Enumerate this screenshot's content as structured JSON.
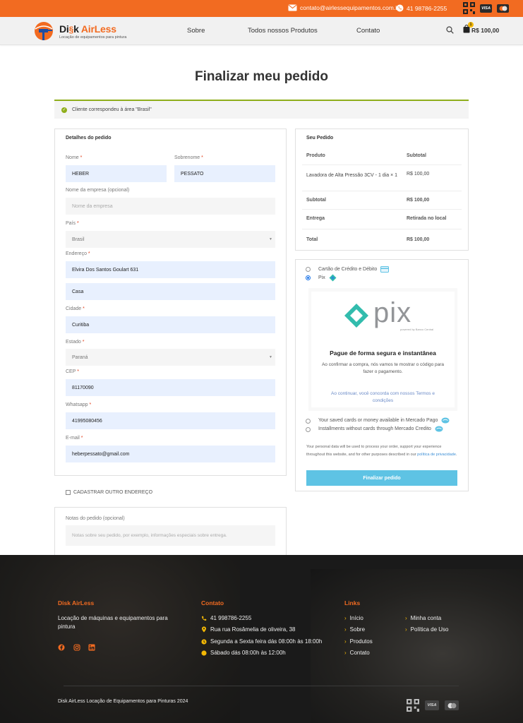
{
  "topbar": {
    "email": "contato@airlessequipamentos.com.br",
    "phone": "41 98786-2255",
    "card_visa": "VISA"
  },
  "header": {
    "logo_brand_1": "Di",
    "logo_brand_2": "k",
    "logo_brand_3": "AirLess",
    "logo_tagline": "Locação de equipamentos para pintura",
    "nav": [
      "Sobre",
      "Todos nossos Produtos",
      "Contato"
    ],
    "cart_count": "1",
    "cart_total": "R$ 100,00"
  },
  "page": {
    "title": "Finalizar meu pedido",
    "notice": "Cliente correspondeu à área \"Brasil\""
  },
  "billing": {
    "heading": "Detalhes do pedido",
    "required_mark": "*",
    "fields": {
      "first_name": {
        "label": "Nome",
        "value": "HEBER"
      },
      "last_name": {
        "label": "Sobrenome",
        "value": "PESSATO"
      },
      "company": {
        "label": "Nome da empresa (opcional)",
        "placeholder": "Nome da empresa"
      },
      "country": {
        "label": "País",
        "value": "Brasil"
      },
      "address": {
        "label": "Endereço",
        "value": "Elvira Dos Santos Goulart 631"
      },
      "address2": {
        "value": "Casa"
      },
      "city": {
        "label": "Cidade",
        "value": "Curitiba"
      },
      "state": {
        "label": "Estado",
        "value": "Paraná"
      },
      "zip": {
        "label": "CEP",
        "value": "81170090"
      },
      "whatsapp": {
        "label": "Whatsapp",
        "value": "41995080456"
      },
      "email": {
        "label": "E-mail",
        "value": "heberpessato@gmail.com"
      }
    },
    "other_address": "CADASTRAR OUTRO ENDEREÇO",
    "notes_label": "Notas do pedido (opcional)",
    "notes_placeholder": "Notas sobre seu pedido, por exemplo, informações especiais sobre entrega."
  },
  "order": {
    "heading": "Seu Pedido",
    "col_product": "Produto",
    "col_subtotal": "Subtotal",
    "item_name": "Lavadora de Alta Pressão 3CV - 1 dia",
    "item_qty": "× 1",
    "item_price": "R$ 100,00",
    "subtotal_label": "Subtotal",
    "subtotal_value": "R$ 100,00",
    "shipping_label": "Entrega",
    "shipping_value": "Retirada no local",
    "total_label": "Total",
    "total_value": "R$ 100,00"
  },
  "payment": {
    "option_card": "Cartão de Crédito e Débito",
    "option_pix": "Pix",
    "pix_logo_text": "pix",
    "pix_powered": "powered by Banco Central",
    "pix_heading": "Pague de forma segura e instantânea",
    "pix_text": "Ao confirmar a compra, nós vamos te mostrar o código para fazer o pagamento.",
    "pix_terms_prefix": "Ao continuar, você concorda com nossos",
    "pix_terms_link": "Termos e condições",
    "option_saved": "Your saved cards or money available in Mercado Pago",
    "option_installments": "Installments without cards through Mercado Credito",
    "privacy_text": "Your personal data will be used to process your order, support your experience throughout this website, and for other purposes described in our",
    "privacy_link": "política de privacidade",
    "privacy_end": ".",
    "submit": "Finalizar pedido"
  },
  "footer": {
    "col1_title": "Disk AirLess",
    "col1_text": "Locação de máquinas e equipamentos para pintura",
    "col2_title": "Contato",
    "contact": [
      "41 998786-2255",
      "Rua rua Rosâmelia de oliveira, 38",
      "Segunda a Sexta feira dás 08:00h às 18:00h",
      "Sábado dás 08:00h às 12:00h"
    ],
    "col3_title": "Links",
    "links_a": [
      "Início",
      "Sobre",
      "Produtos",
      "Contato"
    ],
    "links_b": [
      "Minha conta",
      "Política de Uso"
    ],
    "copyright": "Disk AirLess  Locação de  Equipamentos para Pinturas 2024",
    "card_visa": "VISA"
  },
  "colors": {
    "brand_orange": "#f26b21",
    "accent_green": "#8fae1b",
    "button_blue": "#5ec3e4",
    "pix_teal": "#32bcad"
  }
}
